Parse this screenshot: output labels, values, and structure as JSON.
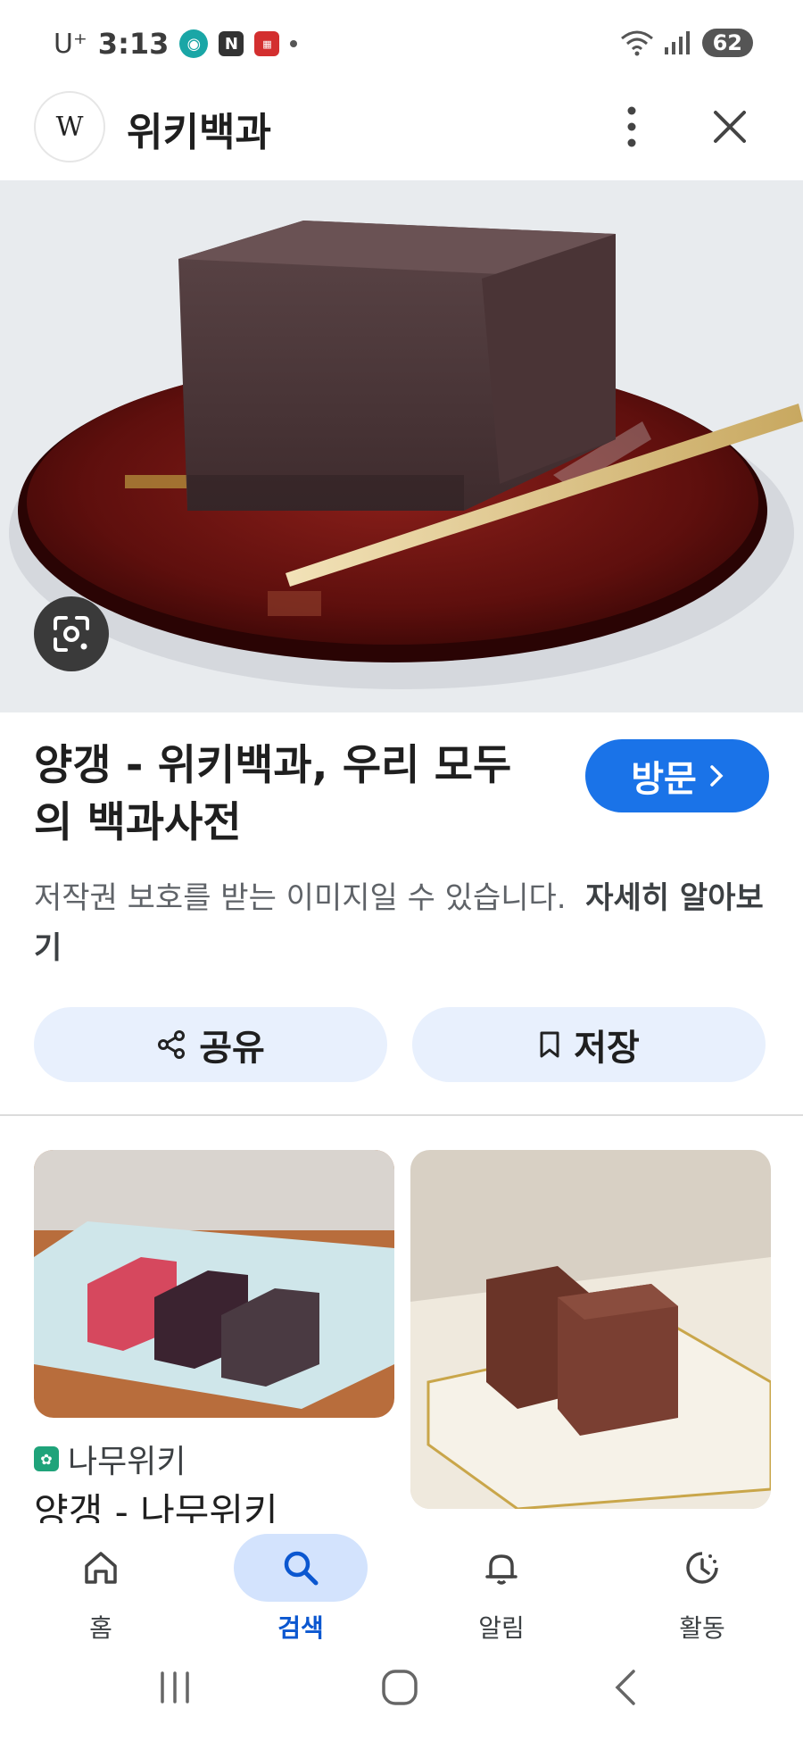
{
  "status_bar": {
    "carrier": "U⁺",
    "time": "3:13",
    "battery": "62",
    "notif_icons": [
      "N"
    ]
  },
  "app_bar": {
    "logo_letter": "W",
    "title": "위키백과"
  },
  "result": {
    "title_line1": "양갱 - 위키백과, 우리 모두",
    "title_line2": "의 백과사전",
    "visit_label": "방문",
    "copyright_note": "저작권 보호를 받는 이미지일 수 있습니다.",
    "learn_more": "자세히 알아보기"
  },
  "actions": {
    "share_label": "공유",
    "save_label": "저장"
  },
  "related": [
    {
      "source": "나무위키",
      "title": "양갱 - 나무위키"
    }
  ],
  "bottom_nav": [
    {
      "label": "홈",
      "icon": "home-icon"
    },
    {
      "label": "검색",
      "icon": "search-icon",
      "active": true
    },
    {
      "label": "알림",
      "icon": "bell-icon"
    },
    {
      "label": "활동",
      "icon": "activity-icon"
    }
  ],
  "colors": {
    "accent": "#1a73e8",
    "pill_bg": "#e8f0fd",
    "active_nav": "#d3e3fd"
  }
}
